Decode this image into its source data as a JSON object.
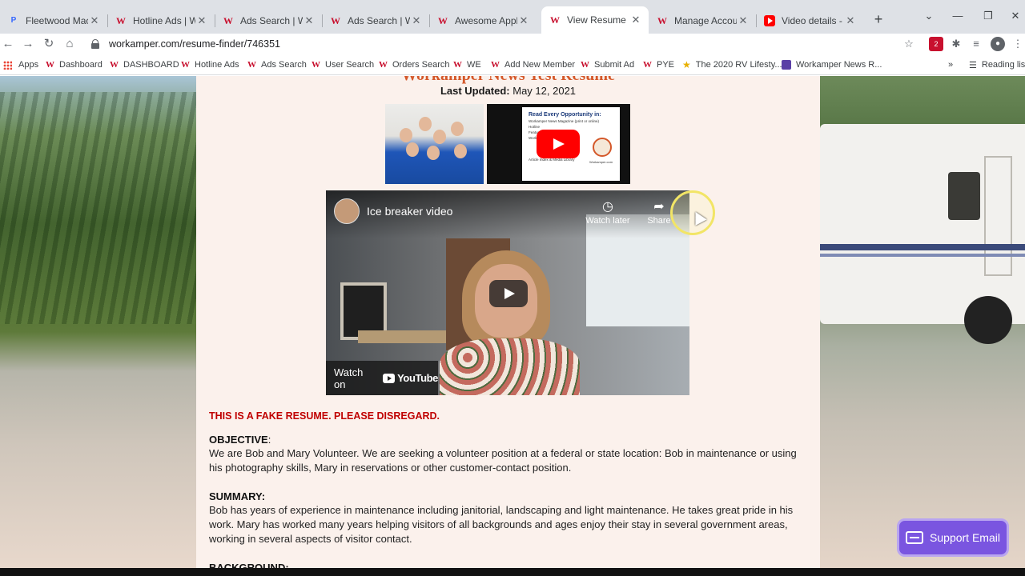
{
  "browser": {
    "tabs": [
      {
        "title": "Fleetwood Mac Radi",
        "icon": "pandora-icon",
        "active": false
      },
      {
        "title": "Hotline Ads | Work",
        "icon": "workamper-icon",
        "active": false
      },
      {
        "title": "Ads Search | Worka",
        "icon": "workamper-icon",
        "active": false
      },
      {
        "title": "Ads Search | Worka",
        "icon": "workamper-icon",
        "active": false
      },
      {
        "title": "Awesome Applicant",
        "icon": "workamper-icon",
        "active": false
      },
      {
        "title": "View Resume | Wo",
        "icon": "workamper-icon",
        "active": true
      },
      {
        "title": "Manage Account |",
        "icon": "workamper-icon",
        "active": false
      },
      {
        "title": "Video details - You",
        "icon": "youtube-icon",
        "active": false
      }
    ],
    "url": "workamper.com/resume-finder/746351",
    "extension_badge": "2",
    "bookmarks": [
      {
        "label": "Apps",
        "icon": "apps-grid-icon"
      },
      {
        "label": "Dashboard",
        "icon": "workamper-icon"
      },
      {
        "label": "DASHBOARD",
        "icon": "workamper-icon"
      },
      {
        "label": "Hotline Ads",
        "icon": "workamper-icon"
      },
      {
        "label": "Ads Search",
        "icon": "workamper-icon"
      },
      {
        "label": "User Search",
        "icon": "workamper-icon"
      },
      {
        "label": "Orders Search",
        "icon": "workamper-icon"
      },
      {
        "label": "WE",
        "icon": "workamper-icon"
      },
      {
        "label": "Add New Member",
        "icon": "workamper-icon"
      },
      {
        "label": "Submit Ad",
        "icon": "workamper-icon"
      },
      {
        "label": "PYE",
        "icon": "workamper-icon"
      },
      {
        "label": "The 2020 RV Lifesty...",
        "icon": "star-icon"
      },
      {
        "label": "Workamper News R...",
        "icon": "purple-doc-icon"
      }
    ],
    "overflow_label": "»",
    "reading_list": "Reading list"
  },
  "resume": {
    "heading": "Workamper News Test Resume",
    "last_updated_label": "Last Updated:",
    "last_updated_value": "May 12, 2021",
    "promo_video": {
      "paper_title": "Read Every Opportunity in:",
      "paper_lines": [
        "Workamper News Magazine (print or online)",
        "Hotline",
        "Featured",
        "Workamper",
        "Article Index & Media Library"
      ],
      "logo_text": "Workamper.com"
    },
    "video": {
      "title": "Ice breaker video",
      "watch_later": "Watch later",
      "share": "Share",
      "watch_on": "Watch on",
      "youtube": "YouTube"
    },
    "fake_notice": "THIS IS A FAKE RESUME.  PLEASE DISREGARD.",
    "objective_heading": "OBJECTIVE",
    "objective_colon": ":",
    "objective_text": "We are Bob and Mary Volunteer. We are seeking a volunteer position at a federal or state location: Bob in maintenance  or using his photography skills, Mary in reservations  or other customer-contact position.",
    "summary_heading": "SUMMARY:",
    "summary_text": "Bob has years of experience in maintenance including janitorial, landscaping and light maintenance. He takes great pride in his work. Mary has worked many years helping visitors of all backgrounds and ages enjoy their stay in several government areas, working in several aspects of visitor contact.",
    "background_heading": "BACKGROUND:"
  },
  "support": {
    "label": "Support Email"
  },
  "colors": {
    "accent": "#d4582a",
    "fake_notice": "#c00000",
    "support_button": "#7a55e0"
  }
}
